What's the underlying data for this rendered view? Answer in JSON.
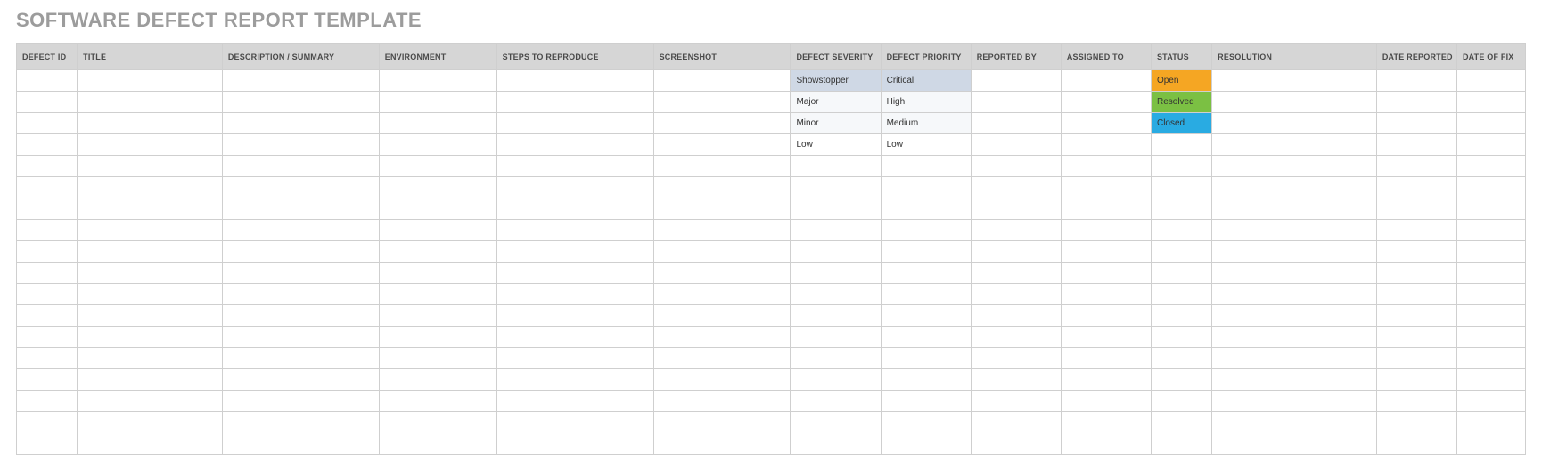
{
  "title": "SOFTWARE DEFECT REPORT TEMPLATE",
  "columns": [
    "DEFECT ID",
    "TITLE",
    "DESCRIPTION / SUMMARY",
    "ENVIRONMENT",
    "STEPS TO REPRODUCE",
    "SCREENSHOT",
    "DEFECT SEVERITY",
    "DEFECT PRIORITY",
    "REPORTED BY",
    "ASSIGNED TO",
    "STATUS",
    "RESOLUTION",
    "DATE REPORTED",
    "DATE OF FIX"
  ],
  "rows": [
    {
      "severity": "Showstopper",
      "priority": "Critical",
      "status": "Open",
      "sev_shade": "sel",
      "pri_shade": "sel",
      "status_class": "status-open"
    },
    {
      "severity": "Major",
      "priority": "High",
      "status": "Resolved",
      "sev_shade": "alt",
      "pri_shade": "alt",
      "status_class": "status-resolved"
    },
    {
      "severity": "Minor",
      "priority": "Medium",
      "status": "Closed",
      "sev_shade": "alt",
      "pri_shade": "alt",
      "status_class": "status-closed"
    },
    {
      "severity": "Low",
      "priority": "Low",
      "status": "",
      "sev_shade": "",
      "pri_shade": "",
      "status_class": ""
    },
    {
      "severity": "",
      "priority": "",
      "status": "",
      "sev_shade": "",
      "pri_shade": "",
      "status_class": ""
    },
    {
      "severity": "",
      "priority": "",
      "status": "",
      "sev_shade": "",
      "pri_shade": "",
      "status_class": ""
    },
    {
      "severity": "",
      "priority": "",
      "status": "",
      "sev_shade": "",
      "pri_shade": "",
      "status_class": ""
    },
    {
      "severity": "",
      "priority": "",
      "status": "",
      "sev_shade": "",
      "pri_shade": "",
      "status_class": ""
    },
    {
      "severity": "",
      "priority": "",
      "status": "",
      "sev_shade": "",
      "pri_shade": "",
      "status_class": ""
    },
    {
      "severity": "",
      "priority": "",
      "status": "",
      "sev_shade": "",
      "pri_shade": "",
      "status_class": ""
    },
    {
      "severity": "",
      "priority": "",
      "status": "",
      "sev_shade": "",
      "pri_shade": "",
      "status_class": ""
    },
    {
      "severity": "",
      "priority": "",
      "status": "",
      "sev_shade": "",
      "pri_shade": "",
      "status_class": ""
    },
    {
      "severity": "",
      "priority": "",
      "status": "",
      "sev_shade": "",
      "pri_shade": "",
      "status_class": ""
    },
    {
      "severity": "",
      "priority": "",
      "status": "",
      "sev_shade": "",
      "pri_shade": "",
      "status_class": ""
    },
    {
      "severity": "",
      "priority": "",
      "status": "",
      "sev_shade": "",
      "pri_shade": "",
      "status_class": ""
    },
    {
      "severity": "",
      "priority": "",
      "status": "",
      "sev_shade": "",
      "pri_shade": "",
      "status_class": ""
    },
    {
      "severity": "",
      "priority": "",
      "status": "",
      "sev_shade": "",
      "pri_shade": "",
      "status_class": ""
    },
    {
      "severity": "",
      "priority": "",
      "status": "",
      "sev_shade": "",
      "pri_shade": "",
      "status_class": ""
    }
  ]
}
